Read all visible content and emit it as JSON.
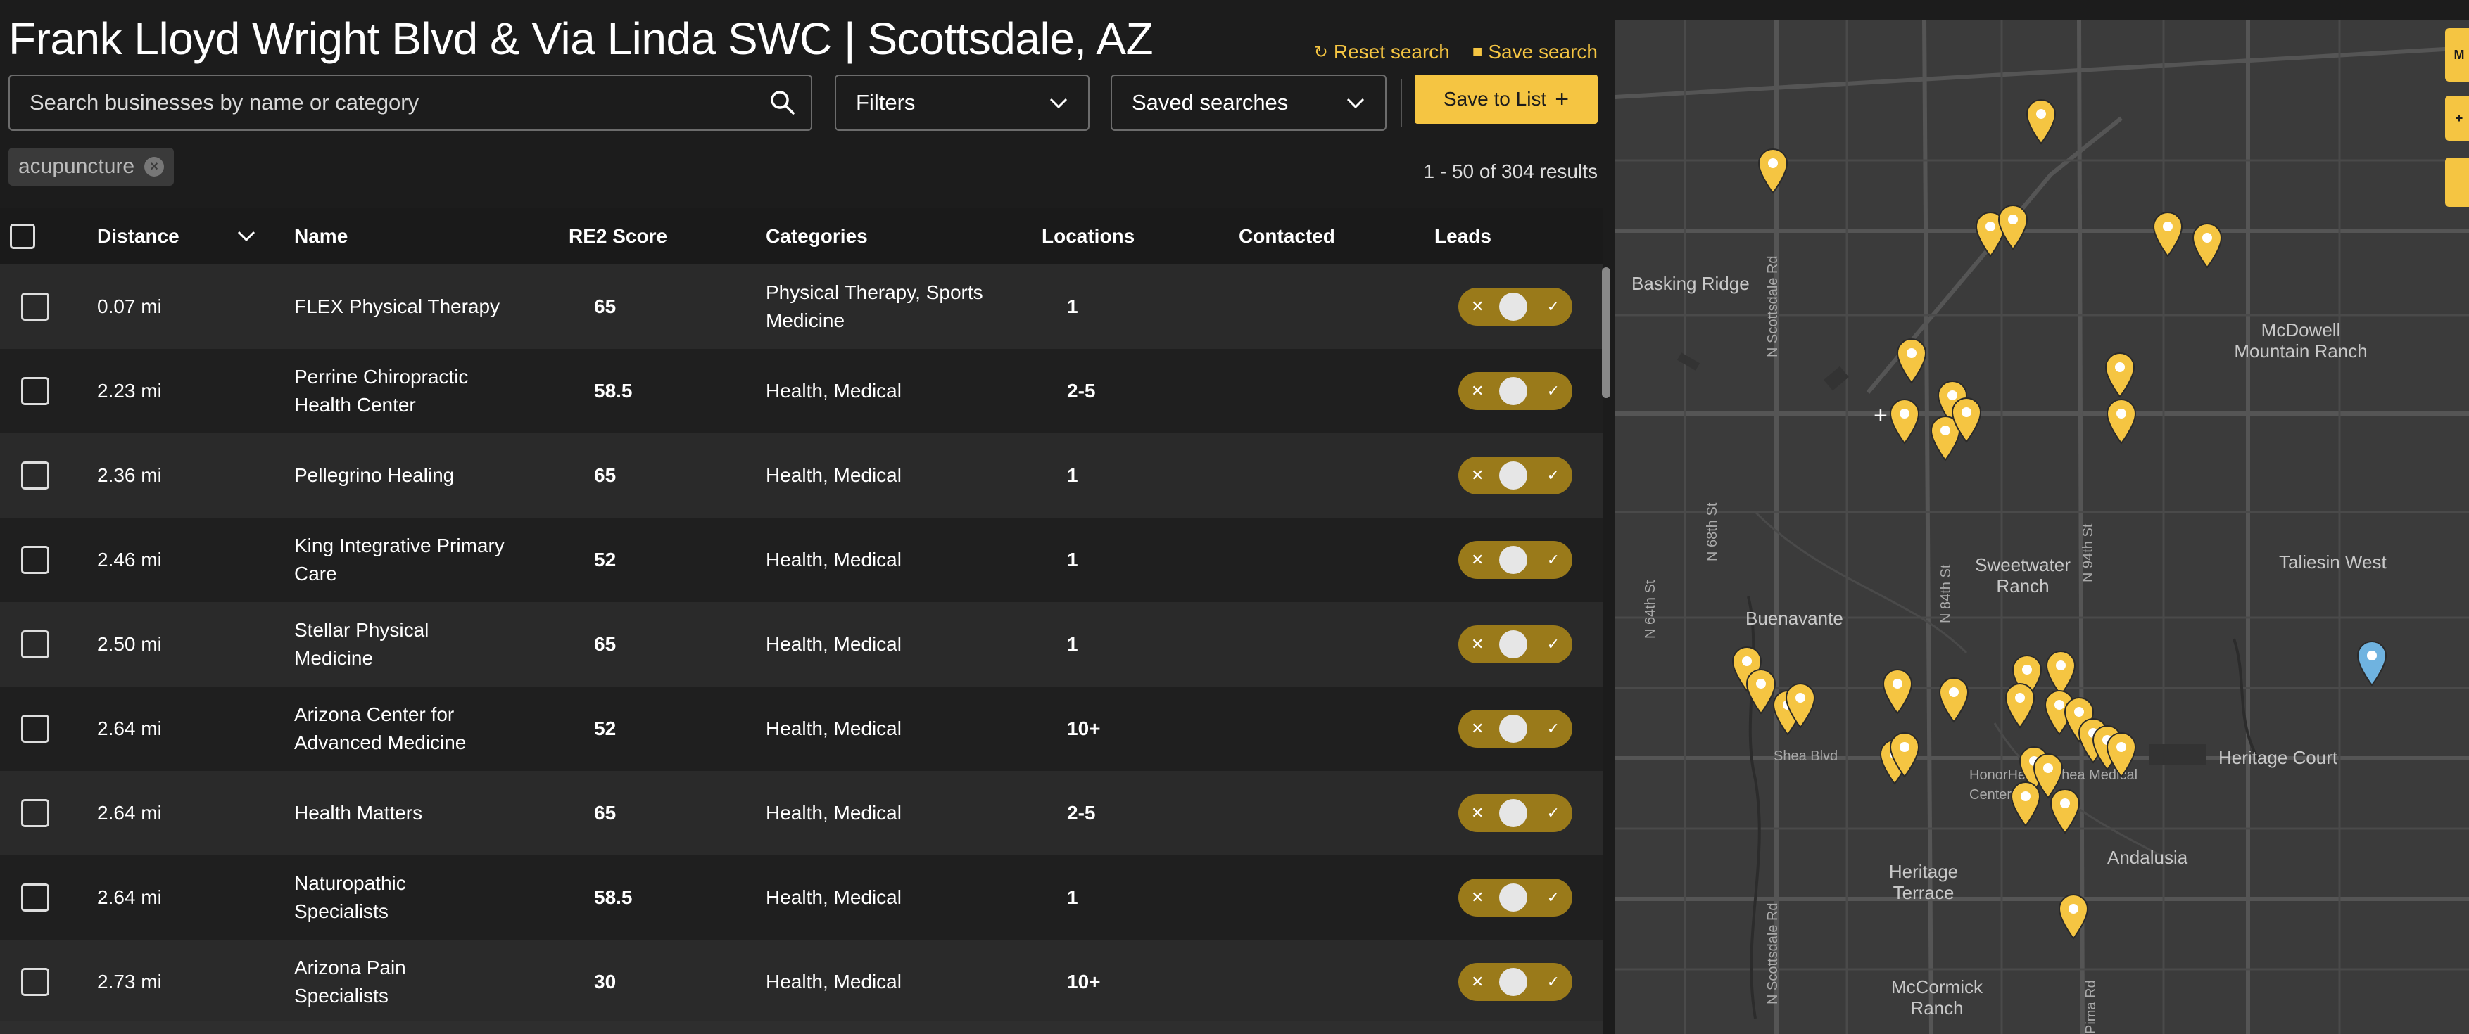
{
  "page": {
    "title": "Frank Lloyd Wright Blvd & Via Linda SWC | Scottsdale, AZ",
    "reset_label": "Reset search",
    "save_search_label": "Save search"
  },
  "toolbar": {
    "search_placeholder": "Search businesses by name or category",
    "filters_label": "Filters",
    "saved_searches_label": "Saved searches",
    "save_to_list_label": "Save to List"
  },
  "chip": {
    "label": "acupuncture"
  },
  "results_text": "1 - 50 of 304 results",
  "table": {
    "headers": {
      "distance": "Distance",
      "name": "Name",
      "score": "RE2 Score",
      "categories": "Categories",
      "locations": "Locations",
      "contacted": "Contacted",
      "leads": "Leads"
    },
    "rows": [
      {
        "distance": "0.07 mi",
        "name": "FLEX Physical Therapy",
        "score": "65",
        "categories": "Physical Therapy, Sports Medicine",
        "locations": "1"
      },
      {
        "distance": "2.23 mi",
        "name": "Perrine Chiropractic Health Center",
        "score": "58.5",
        "categories": "Health, Medical",
        "locations": "2-5"
      },
      {
        "distance": "2.36 mi",
        "name": "Pellegrino Healing",
        "score": "65",
        "categories": "Health, Medical",
        "locations": "1"
      },
      {
        "distance": "2.46 mi",
        "name": "King Integrative Primary Care",
        "score": "52",
        "categories": "Health, Medical",
        "locations": "1"
      },
      {
        "distance": "2.50 mi",
        "name": "Stellar Physical Medicine",
        "score": "65",
        "categories": "Health, Medical",
        "locations": "1"
      },
      {
        "distance": "2.64 mi",
        "name": "Arizona Center for Advanced Medicine",
        "score": "52",
        "categories": "Health, Medical",
        "locations": "10+"
      },
      {
        "distance": "2.64 mi",
        "name": "Health Matters",
        "score": "65",
        "categories": "Health, Medical",
        "locations": "2-5"
      },
      {
        "distance": "2.64 mi",
        "name": "Naturopathic Specialists",
        "score": "58.5",
        "categories": "Health, Medical",
        "locations": "1"
      },
      {
        "distance": "2.73 mi",
        "name": "Arizona Pain Specialists",
        "score": "30",
        "categories": "Health, Medical",
        "locations": "10+"
      }
    ]
  },
  "map": {
    "labels": {
      "basking_ridge": "Basking Ridge",
      "mcdowell": "McDowell Mountain Ranch",
      "taliesin": "Taliesin West",
      "buenavante": "Buenavante",
      "sweetwater": "Sweetwater Ranch",
      "heritage_court": "Heritage Court",
      "andalusia": "Andalusia",
      "heritage_terrace": "Heritage Terrace",
      "mccormick": "McCormick Ranch",
      "honor": "HonorHealth Shea Medical Center",
      "shea": "Shea Blvd",
      "scottsdale_rd": "N Scottsdale Rd",
      "n64": "N 64th St",
      "n68": "N 68th St",
      "n84": "N 84th St",
      "n94": "N 94th St",
      "pima": "Pima Rd"
    },
    "side_labels": [
      "M",
      "+"
    ],
    "colors": {
      "pin": "#f5c542",
      "selected_pin": "#6fb3e0",
      "land": "#3b3b3b",
      "road": "#575757"
    }
  }
}
